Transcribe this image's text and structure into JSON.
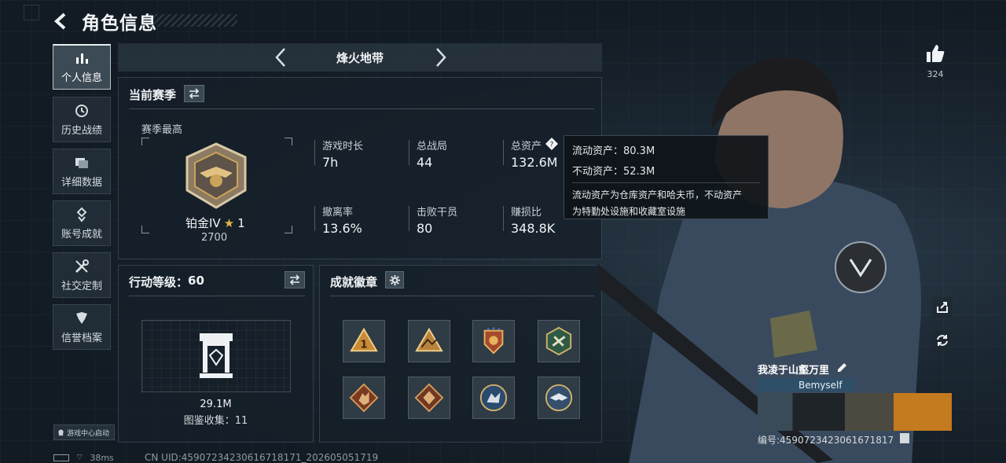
{
  "header": {
    "title": "角色信息"
  },
  "sidebar": {
    "items": [
      {
        "label": "个人信息",
        "icon": "bar-chart-icon",
        "active": true
      },
      {
        "label": "历史战绩",
        "icon": "history-clock-icon",
        "active": false
      },
      {
        "label": "详细数据",
        "icon": "folder-icon",
        "active": false
      },
      {
        "label": "账号成就",
        "icon": "medal-icon",
        "active": false
      },
      {
        "label": "社交定制",
        "icon": "tools-icon",
        "active": false
      },
      {
        "label": "信誉档案",
        "icon": "shield-icon",
        "active": false
      }
    ]
  },
  "mode": {
    "name": "烽火地带"
  },
  "season": {
    "title": "当前赛季",
    "best_label": "赛季最高",
    "rank_name": "铂金IV",
    "rank_stars": "1",
    "rank_score": "2700",
    "stats": [
      {
        "label": "游戏时长",
        "value": "7h"
      },
      {
        "label": "总战局",
        "value": "44"
      },
      {
        "label": "总资产",
        "value": "132.6M"
      },
      {
        "label": "撤离率",
        "value": "13.6%"
      },
      {
        "label": "击败干员",
        "value": "80"
      },
      {
        "label": "赚损比",
        "value": "348.8K"
      }
    ]
  },
  "tooltip": {
    "liquid": "流动资产：80.3M",
    "fixed": "不动资产：52.3M",
    "desc1": "流动资产为仓库资产和哈夫币，不动资产",
    "desc2": "为特勤处设施和收藏室设施"
  },
  "action": {
    "title_prefix": "行动等级：",
    "level": "60",
    "collection_value": "29.1M",
    "collection_label": "图鉴收集：11"
  },
  "achievements": {
    "title": "成就徽章"
  },
  "likes": {
    "count": "324"
  },
  "player": {
    "name": "我凌于山壑万里",
    "nameplate": "Bemyself",
    "uid_label": "编号:4590723423061671817"
  },
  "footer": {
    "launch": "游戏中心启动",
    "ping": "38ms",
    "uid": "CN UID:4590723423061671817​1_202605051719"
  },
  "colors": {
    "accent": "#e6edf0",
    "tooltip_bg": "#0e1318",
    "gold": "#c9a45a"
  }
}
